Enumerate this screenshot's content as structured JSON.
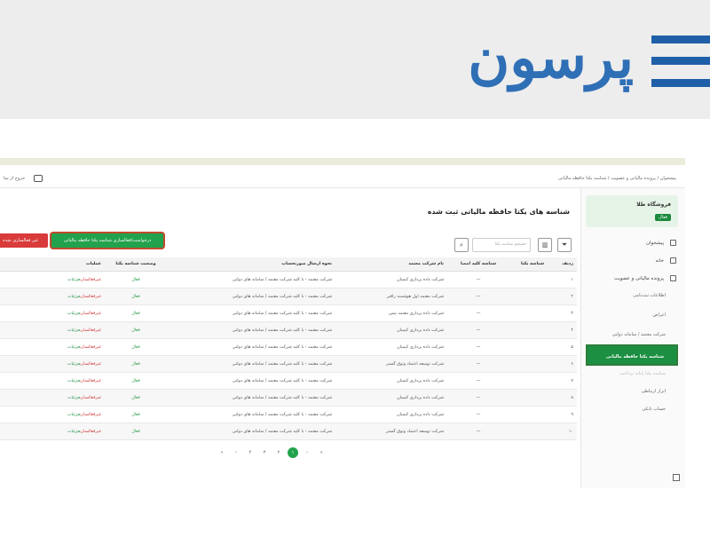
{
  "brand": {
    "logo_text": "پرسون",
    "accent": "#2f6fb6"
  },
  "banner": {
    "menu_icon": "hamburger-icon"
  },
  "topbar": {
    "breadcrumb": "پیشخوان  /  پرونده مالیاتی و عضویت  /  شناسه یکتا حافظه مالیاتی",
    "left_text": "خروج از سا"
  },
  "sidebar": {
    "card_title": "فروشگاه طلا",
    "card_badge": "فعال",
    "items": [
      {
        "label": "پیشخوان",
        "icon": "dashboard-icon"
      },
      {
        "label": "خانه",
        "icon": "home-icon"
      },
      {
        "label": "پرونده مالیاتی و عضویت",
        "icon": "file-icon"
      }
    ],
    "sub_items": [
      {
        "label": "اطلاعات ثبت‌نامی"
      },
      {
        "label": "اعراض"
      },
      {
        "label": "شرکت معتمد / سامانه دولتی"
      },
      {
        "label": "شناسه یکتا حافظه مالیاتی",
        "active": true
      },
      {
        "label": "شناسه یکتا پایانه پرداخت",
        "dim": true
      },
      {
        "label": "ابزار ارتباطی"
      },
      {
        "label": "حساب بانکی"
      }
    ]
  },
  "main": {
    "title": "شناسه های یکتا حافظه مالیاتی ثبت شده",
    "btn_request": "درخواست/فعالسازی شناسه یکتا حافظه مالیاتی",
    "btn_deactivated": "غیر فعالسازی شده",
    "search_placeholder": "جستجو شناسه یکتا"
  },
  "table": {
    "headers": {
      "idx": "ردیف",
      "uid": "شناسه یکتا",
      "mem": "شناسه کلید امضا",
      "co": "نام شرکت معتمد",
      "send": "نحوه ارسال صورتحساب",
      "stat": "وضعیت شناسه یکتا",
      "act": "عملیات"
    },
    "rows": [
      {
        "idx": "۱",
        "mem": "—",
        "co": "شرکت داده پردازی کیمیان",
        "send": "شرکت معتمد - با کلید شرکت معتمد / سامانه های دولتی",
        "stat": "فعال",
        "act1": "غیرفعالسازی",
        "act2": "جزئیات"
      },
      {
        "idx": "۲",
        "mem": "—",
        "co": "شرکت معتمد اول هوشمند رافیر",
        "send": "شرکت معتمد - با کلید شرکت معتمد / سامانه های دولتی",
        "stat": "فعال",
        "act1": "غیرفعالسازی",
        "act2": "جزئیات"
      },
      {
        "idx": "۳",
        "mem": "—",
        "co": "شرکت داده پردازی معتمد نیس",
        "send": "شرکت معتمد - با کلید شرکت معتمد / سامانه های دولتی",
        "stat": "فعال",
        "act1": "غیرفعالسازی",
        "act2": "جزئیات"
      },
      {
        "idx": "۴",
        "mem": "—",
        "co": "شرکت داده پردازی کیمیان",
        "send": "شرکت معتمد - با کلید شرکت معتمد / سامانه های دولتی",
        "stat": "فعال",
        "act1": "غیرفعالسازی",
        "act2": "جزئیات"
      },
      {
        "idx": "۵",
        "mem": "—",
        "co": "شرکت داده پردازی کیمیان",
        "send": "شرکت معتمد - با کلید شرکت معتمد / سامانه های دولتی",
        "stat": "فعال",
        "act1": "غیرفعالسازی",
        "act2": "جزئیات"
      },
      {
        "idx": "۶",
        "mem": "—",
        "co": "شرکت توسعه اعتماد وثوق گستر",
        "send": "شرکت معتمد - با کلید شرکت معتمد / سامانه های دولتی",
        "stat": "فعال",
        "act1": "غیرفعالسازی",
        "act2": "جزئیات"
      },
      {
        "idx": "۷",
        "mem": "—",
        "co": "شرکت داده پردازی کیمیان",
        "send": "شرکت معتمد - با کلید شرکت معتمد / سامانه های دولتی",
        "stat": "فعال",
        "act1": "غیرفعالسازی",
        "act2": "جزئیات"
      },
      {
        "idx": "۸",
        "mem": "—",
        "co": "شرکت داده پردازی کیمیان",
        "send": "شرکت معتمد - با کلید شرکت معتمد / سامانه های دولتی",
        "stat": "فعال",
        "act1": "غیرفعالسازی",
        "act2": "جزئیات"
      },
      {
        "idx": "۹",
        "mem": "—",
        "co": "شرکت داده پردازی کیمیان",
        "send": "شرکت معتمد - با کلید شرکت معتمد / سامانه های دولتی",
        "stat": "فعال",
        "act1": "غیرفعالسازی",
        "act2": "جزئیات"
      },
      {
        "idx": "۱۰",
        "mem": "—",
        "co": "شرکت توسعه اعتماد وثوق گستر",
        "send": "شرکت معتمد - با کلید شرکت معتمد / سامانه های دولتی",
        "stat": "فعال",
        "act1": "غیرفعالسازی",
        "act2": "جزئیات"
      }
    ]
  },
  "pagination": {
    "pages": [
      "«",
      "‹",
      "۴",
      "۳",
      "۲",
      "۱",
      "›",
      "»"
    ],
    "current": "۱"
  }
}
